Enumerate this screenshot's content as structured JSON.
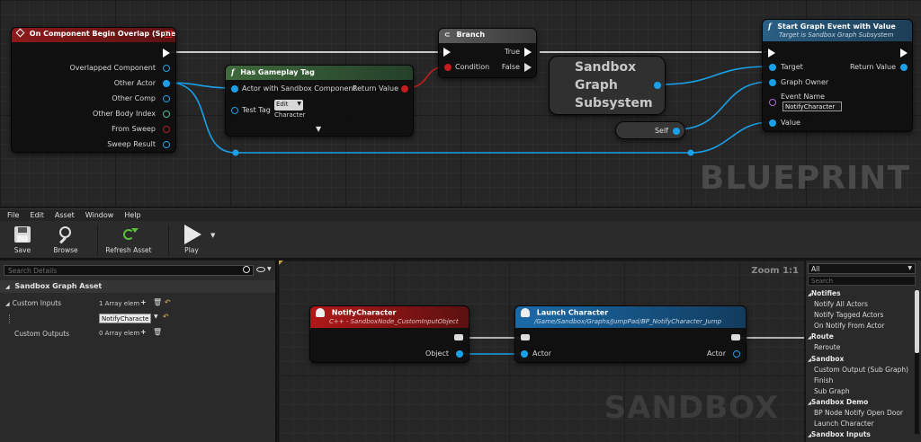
{
  "blueprint": {
    "watermark": "BLUEPRINT",
    "overlap_node": {
      "title": "On Component Begin Overlap (Sphere)",
      "pins": [
        "Overlapped Component",
        "Other Actor",
        "Other Comp",
        "Other Body Index",
        "From Sweep",
        "Sweep Result"
      ]
    },
    "tag_node": {
      "title": "Has Gameplay Tag",
      "actor_pin": "Actor with Sandbox Component",
      "return_pin": "Return Value",
      "test_tag_pin": "Test Tag",
      "edit_label": "Edit",
      "tag_value": "Character",
      "expand_icon": "chevron-down-icon"
    },
    "branch_node": {
      "title": "Branch",
      "condition_pin": "Condition",
      "true_pin": "True",
      "false_pin": "False"
    },
    "subsystem_node": {
      "lines": [
        "Sandbox",
        "Graph",
        "Subsystem"
      ]
    },
    "self_node": {
      "label": "Self"
    },
    "start_node": {
      "title": "Start Graph Event with Value",
      "subtitle": "Target is Sandbox Graph Subsystem",
      "target_pin": "Target",
      "owner_pin": "Graph Owner",
      "event_name_pin": "Event Name",
      "event_name_value": "NotifyCharacter",
      "value_pin": "Value",
      "return_pin": "Return Value"
    }
  },
  "menu": [
    "File",
    "Edit",
    "Asset",
    "Window",
    "Help"
  ],
  "toolbar": {
    "save": "Save",
    "browse": "Browse",
    "refresh": "Refresh Asset",
    "play": "Play"
  },
  "details": {
    "search_placeholder": "Search Details",
    "category": "Sandbox Graph Asset",
    "custom_inputs_label": "Custom Inputs",
    "custom_inputs_value": "1 Array elem",
    "custom_inputs_item": "NotifyCharacte",
    "custom_outputs_label": "Custom Outputs",
    "custom_outputs_value": "0 Array elem"
  },
  "sandbox": {
    "watermark": "SANDBOX",
    "zoom": "Zoom 1:1",
    "notify_node": {
      "title": "NotifyCharacter",
      "subtitle": "C++ - SandboxNode_CustomInputObject",
      "object_pin": "Object"
    },
    "launch_node": {
      "title": "Launch Character",
      "subtitle": "/Game/Sandbox/Graphs/JumpPad/BP_NotifyCharacter_Jump",
      "actor_in_pin": "Actor",
      "actor_out_pin": "Actor"
    }
  },
  "palette": {
    "filter": "All",
    "search_placeholder": "Search",
    "items": [
      {
        "label": "Notifies",
        "cat": true
      },
      {
        "label": "Notify All Actors",
        "cat": false
      },
      {
        "label": "Notify Tagged Actors",
        "cat": false
      },
      {
        "label": "On Notify From Actor",
        "cat": false
      },
      {
        "label": "Route",
        "cat": true
      },
      {
        "label": "Reroute",
        "cat": false
      },
      {
        "label": "Sandbox",
        "cat": true
      },
      {
        "label": "Custom Output (Sub Graph)",
        "cat": false
      },
      {
        "label": "Finish",
        "cat": false
      },
      {
        "label": "Sub Graph",
        "cat": false
      },
      {
        "label": "Sandbox Demo",
        "cat": true
      },
      {
        "label": "BP Node Notify Open Door",
        "cat": false
      },
      {
        "label": "Launch Character",
        "cat": false
      },
      {
        "label": "Sandbox Inputs",
        "cat": true
      }
    ]
  },
  "colors": {
    "event_red": "#8c1a1a",
    "function_green": "#3f6a3c",
    "function_blue": "#2a5f84",
    "pin_blue": "#1aa0e8",
    "pin_red": "#c41d1d"
  }
}
